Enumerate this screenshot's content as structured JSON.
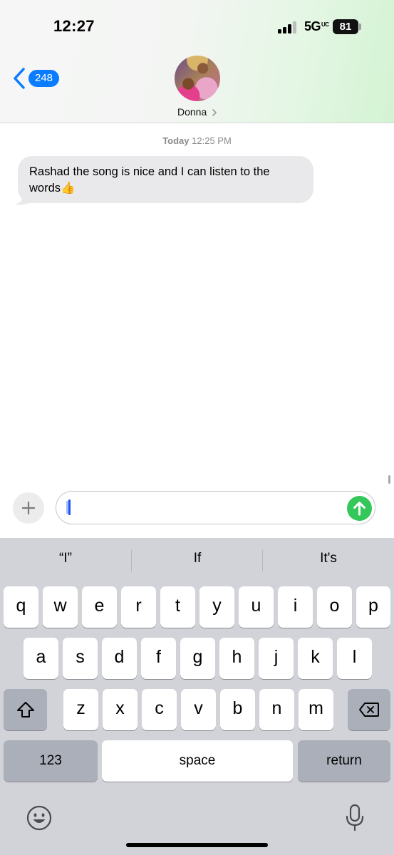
{
  "status_bar": {
    "time": "12:27",
    "network": "5G",
    "network_suffix": "UC",
    "battery": "81"
  },
  "header": {
    "back_badge": "248",
    "contact_name": "Donna",
    "accent_color": "#0a7cff"
  },
  "conversation": {
    "timestamp_day": "Today",
    "timestamp_time": "12:25 PM",
    "messages": [
      {
        "direction": "incoming",
        "text": "Rashad the song is nice and I can listen to the words👍"
      }
    ]
  },
  "compose": {
    "value": "",
    "send_color": "#34c759"
  },
  "keyboard": {
    "predictions": [
      "“I”",
      "If",
      "It's"
    ],
    "row1": [
      "q",
      "w",
      "e",
      "r",
      "t",
      "y",
      "u",
      "i",
      "o",
      "p"
    ],
    "row2": [
      "a",
      "s",
      "d",
      "f",
      "g",
      "h",
      "j",
      "k",
      "l"
    ],
    "row3": [
      "z",
      "x",
      "c",
      "v",
      "b",
      "n",
      "m"
    ],
    "numbers_label": "123",
    "space_label": "space",
    "return_label": "return",
    "icons": [
      "shift-icon",
      "delete-icon",
      "emoji-icon",
      "microphone-icon"
    ]
  }
}
